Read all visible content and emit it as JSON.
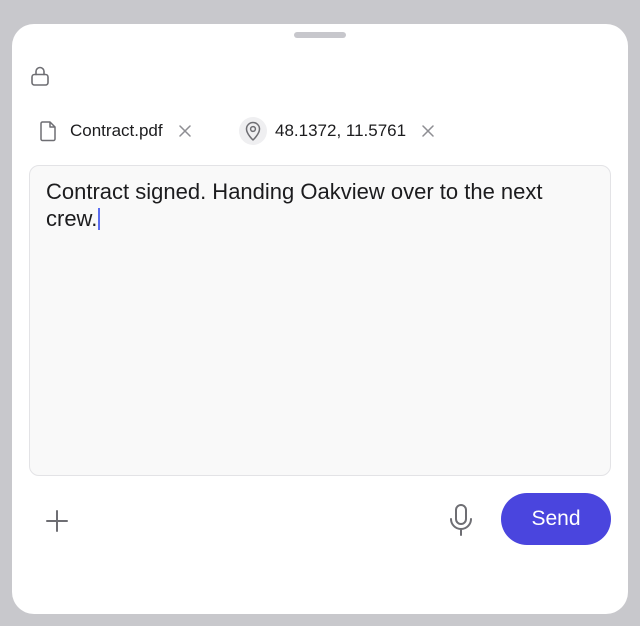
{
  "attachments": [
    {
      "icon": "document-icon",
      "label": "Contract.pdf"
    },
    {
      "icon": "location-pin-icon",
      "label": "48.1372, 11.5761"
    }
  ],
  "message": {
    "text": "Contract signed. Handing Oakview over to the next crew."
  },
  "actions": {
    "send_label": "Send"
  },
  "colors": {
    "accent": "#4a45de",
    "sheet_background": "#ffffff",
    "backdrop": "#c8c8cc"
  }
}
